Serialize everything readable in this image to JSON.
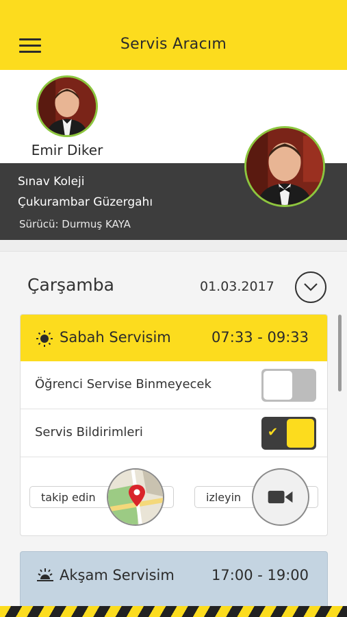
{
  "header": {
    "title": "Servis Aracım",
    "menu_icon": "hamburger-menu-icon"
  },
  "student": {
    "name": "Emir Diker"
  },
  "route_info": {
    "school": "Sınav Koleji",
    "route": "Çukurambar Güzergahı",
    "driver": "Sürücü: Durmuş KAYA"
  },
  "schedule": {
    "day": "Çarşamba",
    "date": "01.03.2017",
    "morning": {
      "label": "Sabah Servisim",
      "time": "07:33 - 09:33",
      "skip_label": "Öğrenci Servise Binmeyecek",
      "skip_on": false,
      "notify_label": "Servis Bildirimleri",
      "notify_on": true,
      "track_label": "takip edin",
      "watch_label": "izleyin"
    },
    "evening": {
      "label": "Akşam Servisim",
      "time": "17:00 - 19:00"
    }
  },
  "colors": {
    "accent": "#fcdc1e",
    "dark": "#3d3d3d",
    "evening": "#c4d4e1",
    "avatar_ring": "#8cc63f"
  }
}
